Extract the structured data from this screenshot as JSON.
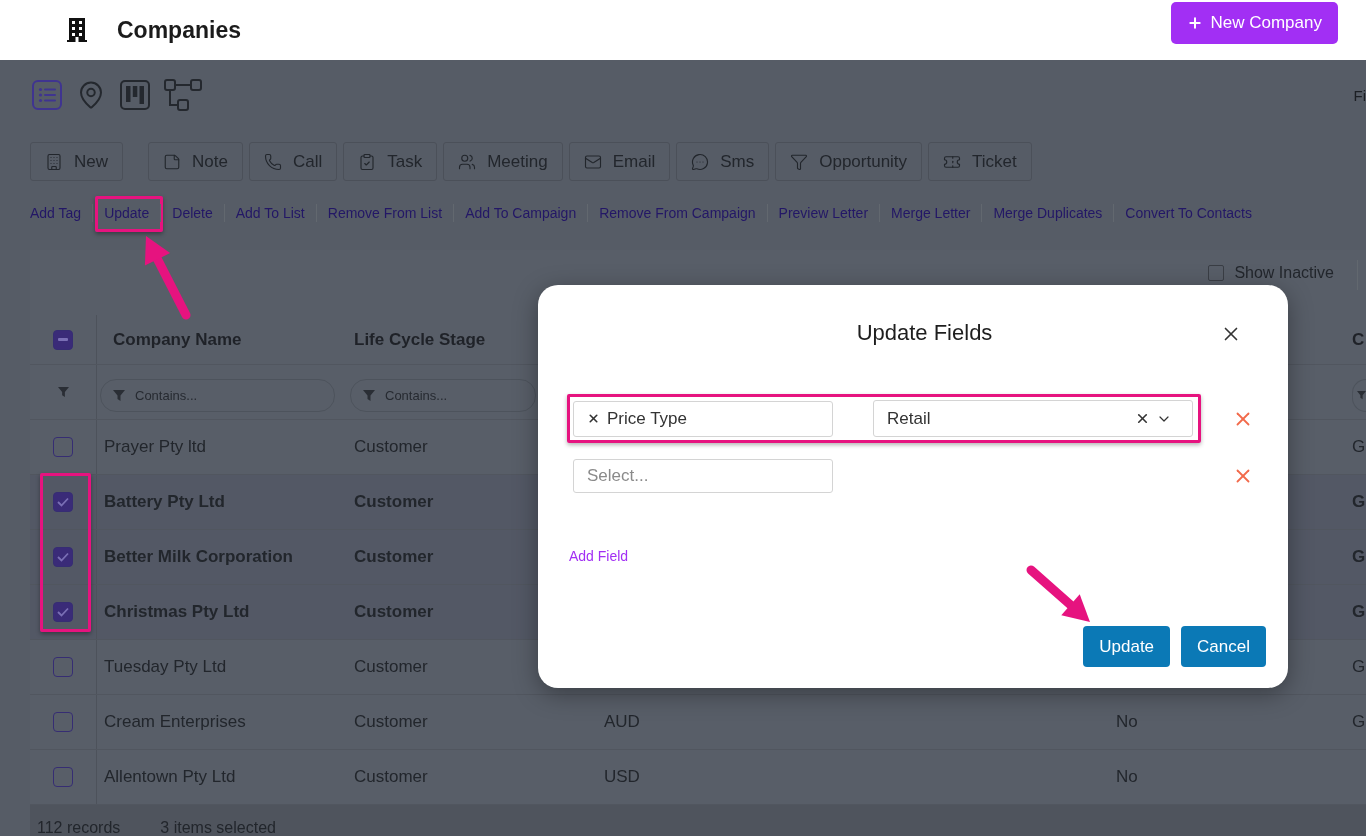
{
  "header": {
    "title": "Companies",
    "new_button": "New Company"
  },
  "views": [
    {
      "kind": "list",
      "selected": true
    },
    {
      "kind": "map",
      "selected": false
    },
    {
      "kind": "kanban",
      "selected": false
    },
    {
      "kind": "hierarchy",
      "selected": false
    }
  ],
  "corner_text": "Fi",
  "toolbar": [
    {
      "items": [
        {
          "kind": "building",
          "label": "New"
        }
      ]
    },
    {
      "items": [
        {
          "kind": "note",
          "label": "Note"
        },
        {
          "kind": "phone",
          "label": "Call"
        },
        {
          "kind": "clipboard",
          "label": "Task"
        },
        {
          "kind": "people",
          "label": "Meeting"
        },
        {
          "kind": "envelope",
          "label": "Email"
        },
        {
          "kind": "chat",
          "label": "Sms"
        },
        {
          "kind": "funnel",
          "label": "Opportunity"
        },
        {
          "kind": "ticket",
          "label": "Ticket"
        }
      ]
    }
  ],
  "actions": [
    {
      "label": "Add Tag",
      "highlighted": false,
      "pointed": false
    },
    {
      "label": "Update",
      "highlighted": true,
      "pointed": true
    },
    {
      "label": "Delete",
      "highlighted": false,
      "pointed": false
    },
    {
      "label": "Add To List",
      "highlighted": false,
      "pointed": false
    },
    {
      "label": "Remove From List",
      "highlighted": false,
      "pointed": false
    },
    {
      "label": "Add To Campaign",
      "highlighted": false,
      "pointed": false
    },
    {
      "label": "Remove From Campaign",
      "highlighted": false,
      "pointed": false
    },
    {
      "label": "Preview Letter",
      "highlighted": false,
      "pointed": false
    },
    {
      "label": "Merge Letter",
      "highlighted": false,
      "pointed": false
    },
    {
      "label": "Merge Duplicates",
      "highlighted": false,
      "pointed": false
    },
    {
      "label": "Convert To Contacts",
      "highlighted": false,
      "pointed": false
    }
  ],
  "table": {
    "show_inactive": {
      "label": "Show Inactive",
      "checked": false
    },
    "select_all": {
      "indeterminate": true
    },
    "columns": {
      "company_name": {
        "label": "Company Name",
        "filter_placeholder": "Contains..."
      },
      "life_cycle_stage": {
        "label": "Life Cycle Stage",
        "filter_placeholder": "Contains..."
      },
      "column_5": {
        "label": "C"
      }
    },
    "rows": [
      {
        "selected": false,
        "highlighted": false,
        "company_name": "Prayer Pty ltd",
        "life_cycle_stage": "Customer",
        "column_5": "G"
      },
      {
        "selected": true,
        "highlighted": true,
        "company_name": "Battery Pty Ltd",
        "life_cycle_stage": "Customer",
        "column_5": "G"
      },
      {
        "selected": true,
        "highlighted": true,
        "company_name": "Better Milk Corporation",
        "life_cycle_stage": "Customer",
        "column_5": "G"
      },
      {
        "selected": true,
        "highlighted": true,
        "company_name": "Christmas Pty Ltd",
        "life_cycle_stage": "Customer",
        "column_5": "G"
      },
      {
        "selected": false,
        "highlighted": false,
        "company_name": "Tuesday Pty Ltd",
        "life_cycle_stage": "Customer",
        "column_5": "G"
      },
      {
        "selected": false,
        "highlighted": false,
        "company_name": "Cream Enterprises",
        "life_cycle_stage": "Customer",
        "column_3": "AUD",
        "column_4": "No",
        "column_5": "G"
      },
      {
        "selected": false,
        "highlighted": false,
        "company_name": "Allentown Pty Ltd",
        "life_cycle_stage": "Customer",
        "column_3": "USD",
        "column_4": "No"
      }
    ],
    "footer": {
      "records": "112 records",
      "selection": "3 items selected"
    }
  },
  "dialog": {
    "title": "Update Fields",
    "rows": [
      {
        "field": "Price Type",
        "value": "Retail",
        "highlighted": true
      },
      {
        "field_placeholder": "Select...",
        "highlighted": false
      }
    ],
    "add_link": "Add Field",
    "buttons": [
      {
        "label": "Update",
        "pointed": true
      },
      {
        "label": "Cancel",
        "pointed": false
      }
    ]
  }
}
